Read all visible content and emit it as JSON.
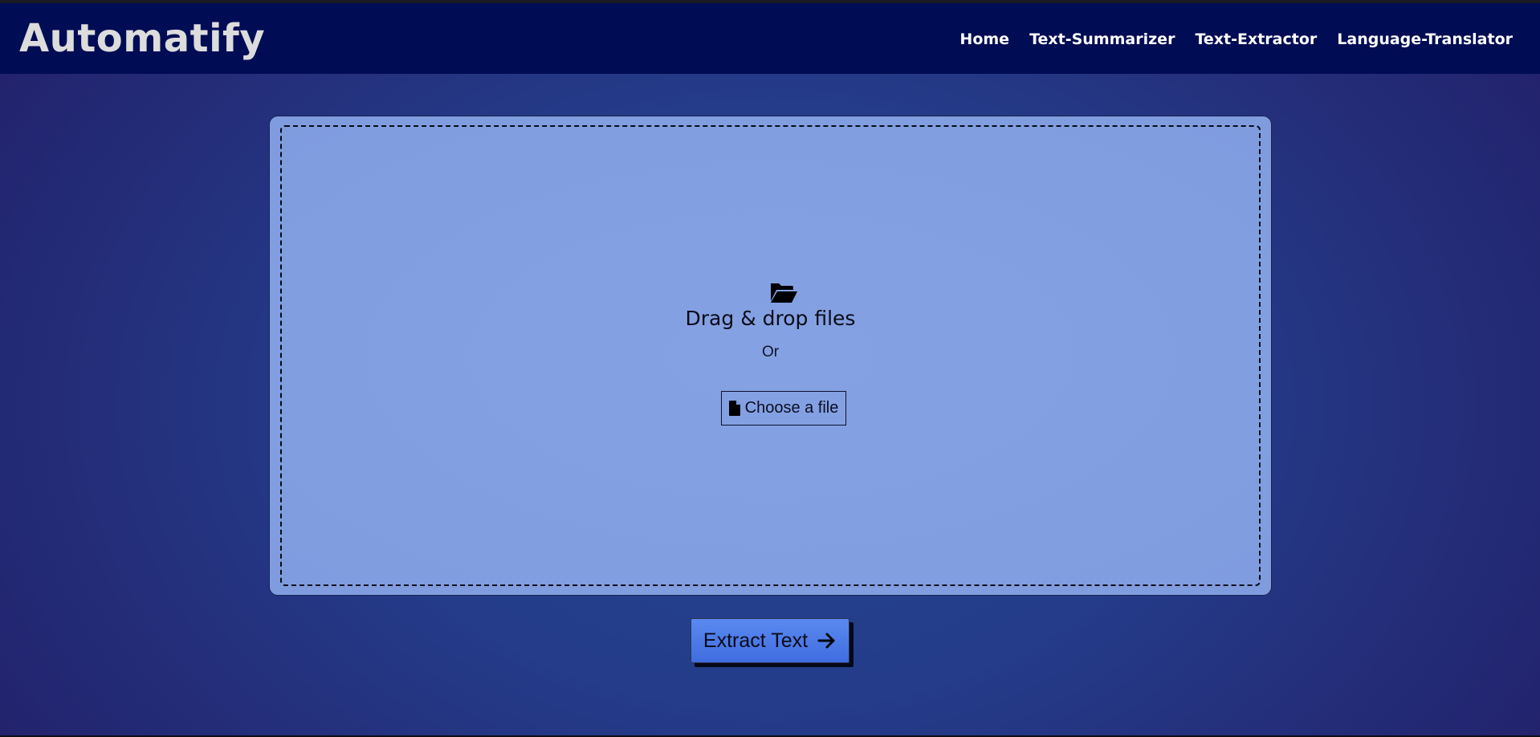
{
  "navbar": {
    "brand": "Automatify",
    "links": [
      "Home",
      "Text-Summarizer",
      "Text-Extractor",
      "Language-Translator"
    ]
  },
  "dropzone": {
    "icon": "folder-open-icon",
    "title": "Drag & drop files",
    "or_text": "Or",
    "choose_label": "Choose a file",
    "choose_icon": "file-icon"
  },
  "actions": {
    "extract_label": "Extract Text",
    "extract_icon": "arrow-right-icon"
  },
  "colors": {
    "navbar": "#000c54",
    "background": "#243c8a",
    "card": "#819fe1",
    "button": "#4a7be8"
  }
}
